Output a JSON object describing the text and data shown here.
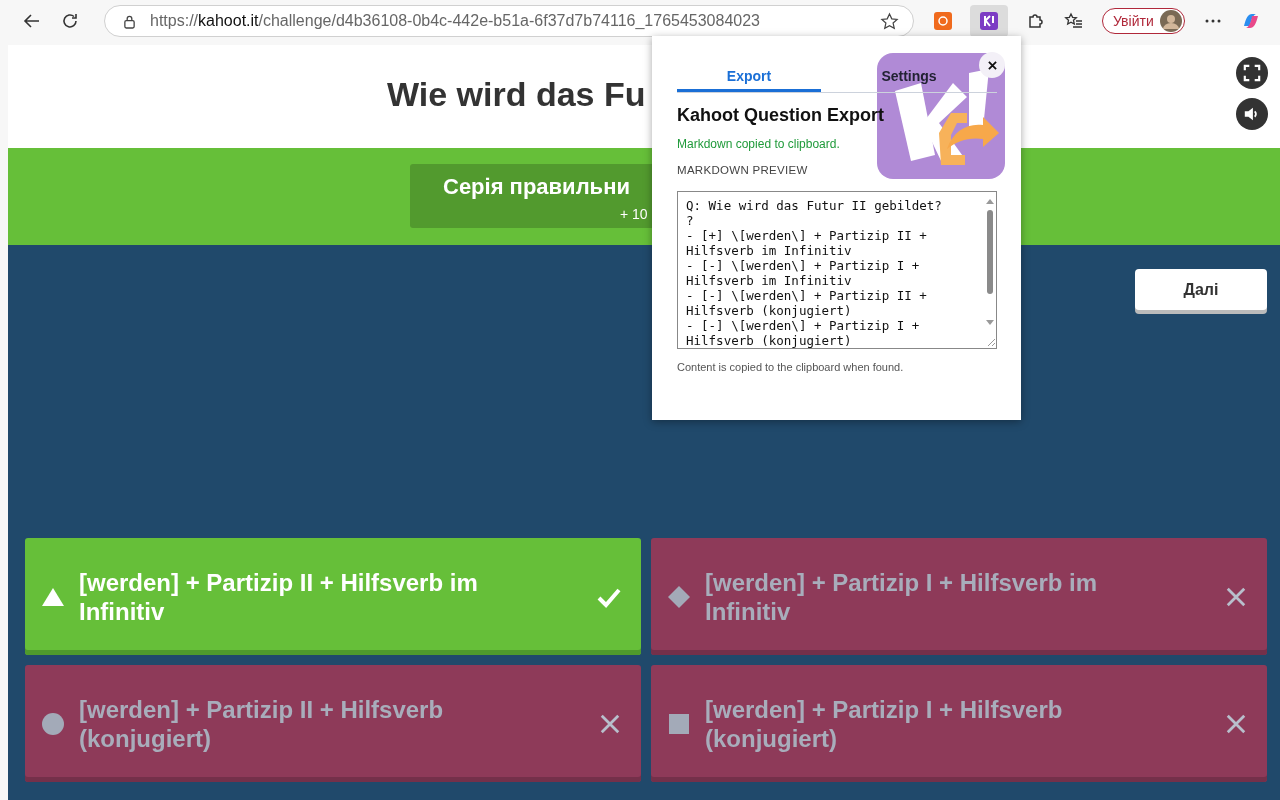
{
  "browser": {
    "url": "https://**kahoot.it**/challenge/d4b36108-0b4c-442e-b51a-6f37d7b74116_1765453084023",
    "profile_button": "Увійти"
  },
  "question": {
    "title": "Wie wird das Fu"
  },
  "streak": {
    "title": "Серія правильни",
    "points": "+ 10"
  },
  "next_button": "Далі",
  "answers": [
    {
      "kind": "triangle",
      "text": "[werden] + Partizip II + Hilfsverb im Infinitiv",
      "correct": true
    },
    {
      "kind": "diamond",
      "text": "[werden] + Partizip I + Hilfsverb im Infinitiv",
      "correct": false
    },
    {
      "kind": "circle",
      "text": "[werden] + Partizip II + Hilfsverb (konjugiert)",
      "correct": false
    },
    {
      "kind": "square",
      "text": "[werden] + Partizip I + Hilfsverb (konjugiert)",
      "correct": false
    }
  ],
  "popup": {
    "tabs": [
      {
        "label": "Export",
        "selected": true
      },
      {
        "label": "Settings",
        "selected": false
      }
    ],
    "heading": "Kahoot Question Export",
    "status": "Markdown copied to clipboard.",
    "section_label": "MARKDOWN PREVIEW",
    "preview_lines": [
      "Q: Wie wird das Futur II gebildet?",
      "?",
      "- [+] \\[werden\\] + Partizip II +",
      "Hilfsverb im Infinitiv",
      "- [-] \\[werden\\] + Partizip I +",
      "Hilfsverb im Infinitiv",
      "- [-] \\[werden\\] + Partizip II +",
      "Hilfsverb (konjugiert)",
      "- [-] \\[werden\\] + Partizip I +",
      "Hilfsverb (konjugiert)"
    ],
    "footer": "Content is copied to the clipboard when found."
  }
}
